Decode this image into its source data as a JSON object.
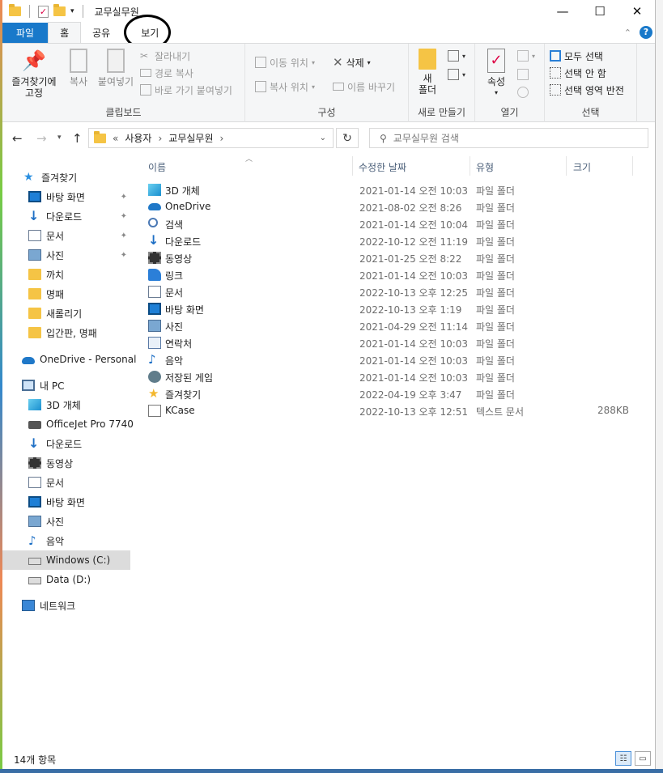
{
  "window": {
    "title": "교무실무원"
  },
  "ribbon_tabs": [
    "파일",
    "홈",
    "공유",
    "보기"
  ],
  "ribbon": {
    "clipboard": {
      "pin": "즐겨찾기에\n고정",
      "copy": "복사",
      "paste": "붙여넣기",
      "cut": "잘라내기",
      "copy_path": "경로 복사",
      "paste_shortcut": "바로 가기 붙여넣기",
      "label": "클립보드"
    },
    "organize": {
      "move_to": "이동 위치",
      "copy_to": "복사 위치",
      "delete": "삭제",
      "rename": "이름 바꾸기",
      "label": "구성"
    },
    "new": {
      "new_folder": "새\n폴더",
      "label": "새로 만들기"
    },
    "open": {
      "properties": "속성",
      "label": "열기"
    },
    "select": {
      "select_all": "모두 선택",
      "select_none": "선택 안 함",
      "invert": "선택 영역 반전",
      "label": "선택"
    }
  },
  "address": {
    "prefix": "«",
    "crumbs": [
      "사용자",
      "교무실무원"
    ],
    "separator": "›"
  },
  "search": {
    "placeholder": "교무실무원 검색"
  },
  "sidebar": {
    "quick_access": "즐겨찾기",
    "quick_items": [
      "바탕 화면",
      "다운로드",
      "문서",
      "사진",
      "까치",
      "명패",
      "새롤리기",
      "입간판, 명패"
    ],
    "onedrive": "OneDrive - Personal",
    "this_pc": "내 PC",
    "pc_items": [
      "3D 개체",
      "OfficeJet Pro 7740",
      "다운로드",
      "동영상",
      "문서",
      "바탕 화면",
      "사진",
      "음악",
      "Windows (C:)",
      "Data (D:)"
    ],
    "network": "네트워크"
  },
  "columns": {
    "name": "이름",
    "date": "수정한 날짜",
    "type": "유형",
    "size": "크기"
  },
  "files": [
    {
      "name": "3D 개체",
      "date": "2021-01-14 오전 10:03",
      "type": "파일 폴더",
      "size": "",
      "icon": "cube"
    },
    {
      "name": "OneDrive",
      "date": "2021-08-02 오전 8:26",
      "type": "파일 폴더",
      "size": "",
      "icon": "cloud"
    },
    {
      "name": "검색",
      "date": "2021-01-14 오전 10:04",
      "type": "파일 폴더",
      "size": "",
      "icon": "search"
    },
    {
      "name": "다운로드",
      "date": "2022-10-12 오전 11:19",
      "type": "파일 폴더",
      "size": "",
      "icon": "arrow"
    },
    {
      "name": "동영상",
      "date": "2021-01-25 오전 8:22",
      "type": "파일 폴더",
      "size": "",
      "icon": "film"
    },
    {
      "name": "링크",
      "date": "2021-01-14 오전 10:03",
      "type": "파일 폴더",
      "size": "",
      "icon": "link"
    },
    {
      "name": "문서",
      "date": "2022-10-13 오후 12:25",
      "type": "파일 폴더",
      "size": "",
      "icon": "doc"
    },
    {
      "name": "바탕 화면",
      "date": "2022-10-13 오후 1:19",
      "type": "파일 폴더",
      "size": "",
      "icon": "desk"
    },
    {
      "name": "사진",
      "date": "2021-04-29 오전 11:14",
      "type": "파일 폴더",
      "size": "",
      "icon": "pic"
    },
    {
      "name": "연락처",
      "date": "2021-01-14 오전 10:03",
      "type": "파일 폴더",
      "size": "",
      "icon": "contact"
    },
    {
      "name": "음악",
      "date": "2021-01-14 오전 10:03",
      "type": "파일 폴더",
      "size": "",
      "icon": "note"
    },
    {
      "name": "저장된 게임",
      "date": "2021-01-14 오전 10:03",
      "type": "파일 폴더",
      "size": "",
      "icon": "game"
    },
    {
      "name": "즐겨찾기",
      "date": "2022-04-19 오후 3:47",
      "type": "파일 폴더",
      "size": "",
      "icon": "fav"
    },
    {
      "name": "KCase",
      "date": "2022-10-13 오후 12:51",
      "type": "텍스트 문서",
      "size": "288KB",
      "icon": "text"
    }
  ],
  "status": {
    "count": "14개 항목"
  }
}
